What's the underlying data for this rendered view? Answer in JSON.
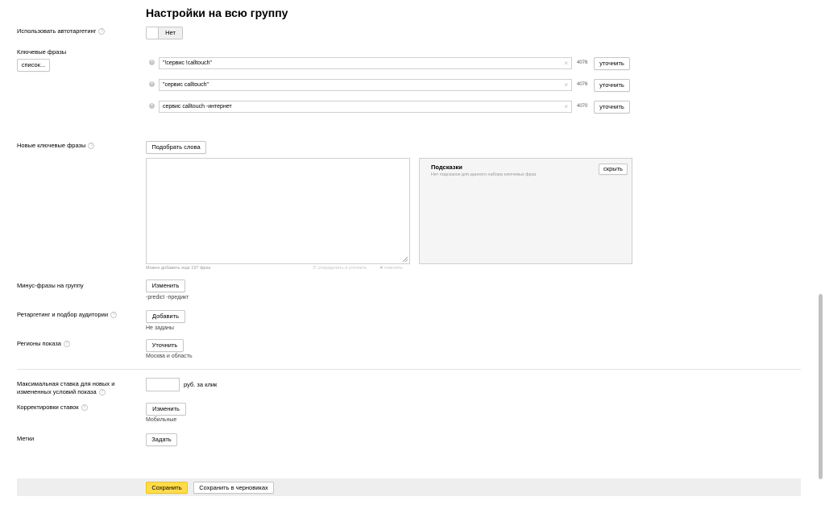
{
  "page_title": "Настройки на всю группу",
  "autotargeting": {
    "label": "Использовать автотаргетинг",
    "toggle_state": "Нет"
  },
  "keywords": {
    "label": "Ключевые фразы",
    "list_button": "список...",
    "refine_label": "уточнить",
    "items": [
      {
        "text": "\"!сервис !calltouch\"",
        "count": "4076"
      },
      {
        "text": "\"сервис calltouch\"",
        "count": "4076"
      },
      {
        "text": "сервис calltouch -интернет",
        "count": "4070"
      }
    ]
  },
  "new_keywords": {
    "label": "Новые ключевые фразы",
    "pick_button": "Подобрать слова",
    "textarea_value": "",
    "remaining_note": "Можно добавить еще 197 фраз",
    "sort_link": "упорядочить и уточнить",
    "clear_link": "очистить"
  },
  "hints": {
    "title": "Подсказки",
    "hide_button": "скрыть",
    "empty_text": "Нет подсказок для данного набора ключевых фраз"
  },
  "minus_phrases": {
    "label": "Минус-фразы на группу",
    "button": "Изменить",
    "value": "-predict -предикт"
  },
  "retargeting": {
    "label": "Ретаргетинг и подбор аудитории",
    "button": "Добавить",
    "value": "Не заданы"
  },
  "regions": {
    "label": "Регионы показа",
    "button": "Уточнить",
    "value": "Москва и область"
  },
  "max_bid": {
    "label_line1": "Максимальная ставка для новых и",
    "label_line2": "измененных условий показа",
    "input_value": "",
    "unit": "руб. за клик"
  },
  "bid_adjustments": {
    "label": "Корректировки ставок",
    "button": "Изменить",
    "value": "Мобильные"
  },
  "tags": {
    "label": "Метки",
    "button": "Задать"
  },
  "footer": {
    "save_button": "Сохранить",
    "draft_button": "Сохранить в черновиках"
  },
  "help_glyph": "?",
  "colors": {
    "save_accent": "#ffdb4d",
    "footer_bg": "#eeeeee",
    "hints_bg": "#f5f5f5"
  }
}
